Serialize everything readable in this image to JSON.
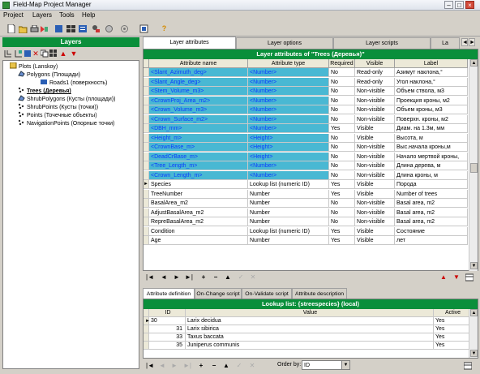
{
  "window": {
    "title": "Field-Map Project Manager"
  },
  "menu": [
    "Project",
    "Layers",
    "Tools",
    "Help"
  ],
  "layers_panel": {
    "header": "Layers",
    "tree": [
      {
        "label": "Plots (Lanskoy)",
        "bold": false
      },
      {
        "label": "Polygons (Площади)",
        "bold": false
      },
      {
        "label": "Roads1 (поверхность)",
        "bold": false
      },
      {
        "label": "Trees (Деревья)",
        "bold": true
      },
      {
        "label": "ShrubPolygons (Кусты (площади))",
        "bold": false
      },
      {
        "label": "ShrubPoints (Кусты (точки))",
        "bold": false
      },
      {
        "label": "Points (Точечные объекты)",
        "bold": false
      },
      {
        "label": "NavigationPoints (Опорные точки)",
        "bold": false
      }
    ]
  },
  "main_tabs": [
    "Layer attributes",
    "Layer options",
    "Layer scripts",
    "La"
  ],
  "attributes_grid": {
    "title": "Layer attributes of \"Trees (Деревья)\"",
    "columns": [
      "Attribute name",
      "Attribute type",
      "Required",
      "Visible",
      "Label"
    ],
    "rows": [
      {
        "name": "<Slant_Azimuth_deg>",
        "type": "<Number>",
        "required": "No",
        "visible": "Read-only",
        "label": "Азимут наклона,°",
        "selected": true
      },
      {
        "name": "<Slant_Angle_deg>",
        "type": "<Number>",
        "required": "No",
        "visible": "Read-only",
        "label": "Угол наклона,°",
        "selected": true
      },
      {
        "name": "<Stem_Volume_m3>",
        "type": "<Number>",
        "required": "No",
        "visible": "Non-visible",
        "label": "Объем ствола, м3",
        "selected": true
      },
      {
        "name": "<CrownProj_Area_m2>",
        "type": "<Number>",
        "required": "No",
        "visible": "Non-visible",
        "label": "Проекция кроны, м2",
        "selected": true
      },
      {
        "name": "<Crown_Volume_m3>",
        "type": "<Number>",
        "required": "No",
        "visible": "Non-visible",
        "label": "Объем кроны, м3",
        "selected": true
      },
      {
        "name": "<Crown_Surface_m2>",
        "type": "<Number>",
        "required": "No",
        "visible": "Non-visible",
        "label": "Поверхн. кроны, м2",
        "selected": true
      },
      {
        "name": "<DBH_mm>",
        "type": "<Number>",
        "required": "Yes",
        "visible": "Visible",
        "label": "Диам. на 1.3м, мм",
        "selected": true
      },
      {
        "name": "<Height_m>",
        "type": "<Height>",
        "required": "No",
        "visible": "Visible",
        "label": "Высота, м",
        "selected": true
      },
      {
        "name": "<CrownBase_m>",
        "type": "<Height>",
        "required": "No",
        "visible": "Non-visible",
        "label": "Выс.начала кроны,м",
        "selected": true
      },
      {
        "name": "<DeadCrBase_m>",
        "type": "<Height>",
        "required": "No",
        "visible": "Non-visible",
        "label": "Начало мертвой кроны,",
        "selected": true
      },
      {
        "name": "<Tree_Length_m>",
        "type": "<Number>",
        "required": "No",
        "visible": "Non-visible",
        "label": "Длина дерева, м",
        "selected": true
      },
      {
        "name": "<Crown_Length_m>",
        "type": "<Number>",
        "required": "No",
        "visible": "Non-visible",
        "label": "Длина кроны, м",
        "selected": true
      },
      {
        "name": "Species",
        "type": "Lookup list (numeric ID)",
        "required": "Yes",
        "visible": "Visible",
        "label": "Порода",
        "selected": false,
        "current": true
      },
      {
        "name": "TreeNumber",
        "type": "Number",
        "required": "Yes",
        "visible": "Visible",
        "label": "Number of trees",
        "selected": false
      },
      {
        "name": "BasalArea_m2",
        "type": "Number",
        "required": "No",
        "visible": "Non-visible",
        "label": "Basal area, m2",
        "selected": false
      },
      {
        "name": "AdjustBasalArea_m2",
        "type": "Number",
        "required": "No",
        "visible": "Non-visible",
        "label": "Basal area, m2",
        "selected": false
      },
      {
        "name": "RepreBasalArea_m2",
        "type": "Number",
        "required": "No",
        "visible": "Non-visible",
        "label": "Basal area, m2",
        "selected": false
      },
      {
        "name": "Condition",
        "type": "Lookup list (numeric ID)",
        "required": "Yes",
        "visible": "Visible",
        "label": "Состояние",
        "selected": false
      },
      {
        "name": "Age",
        "type": "Number",
        "required": "Yes",
        "visible": "Visible",
        "label": "лет",
        "selected": false
      }
    ]
  },
  "bottom_tabs": [
    "Attribute definition",
    "On-Change script",
    "On-Validate script",
    "Attribute description"
  ],
  "lookup": {
    "title": "Lookup list: {streespecies} (local)",
    "columns": [
      "ID",
      "Value",
      "Active"
    ],
    "rows": [
      {
        "id": "30",
        "value": "Larix decidua",
        "active": "Yes"
      },
      {
        "id": "31",
        "value": "Larix sibirica",
        "active": "Yes"
      },
      {
        "id": "33",
        "value": "Taxus baccata",
        "active": "Yes"
      },
      {
        "id": "35",
        "value": "Juniperus communis",
        "active": "Yes"
      }
    ]
  },
  "order_by": {
    "label": "Order by:",
    "value": "ID"
  },
  "colors": {
    "accent_green": "#0a8f3b",
    "selection_cyan": "#49b8d3"
  }
}
